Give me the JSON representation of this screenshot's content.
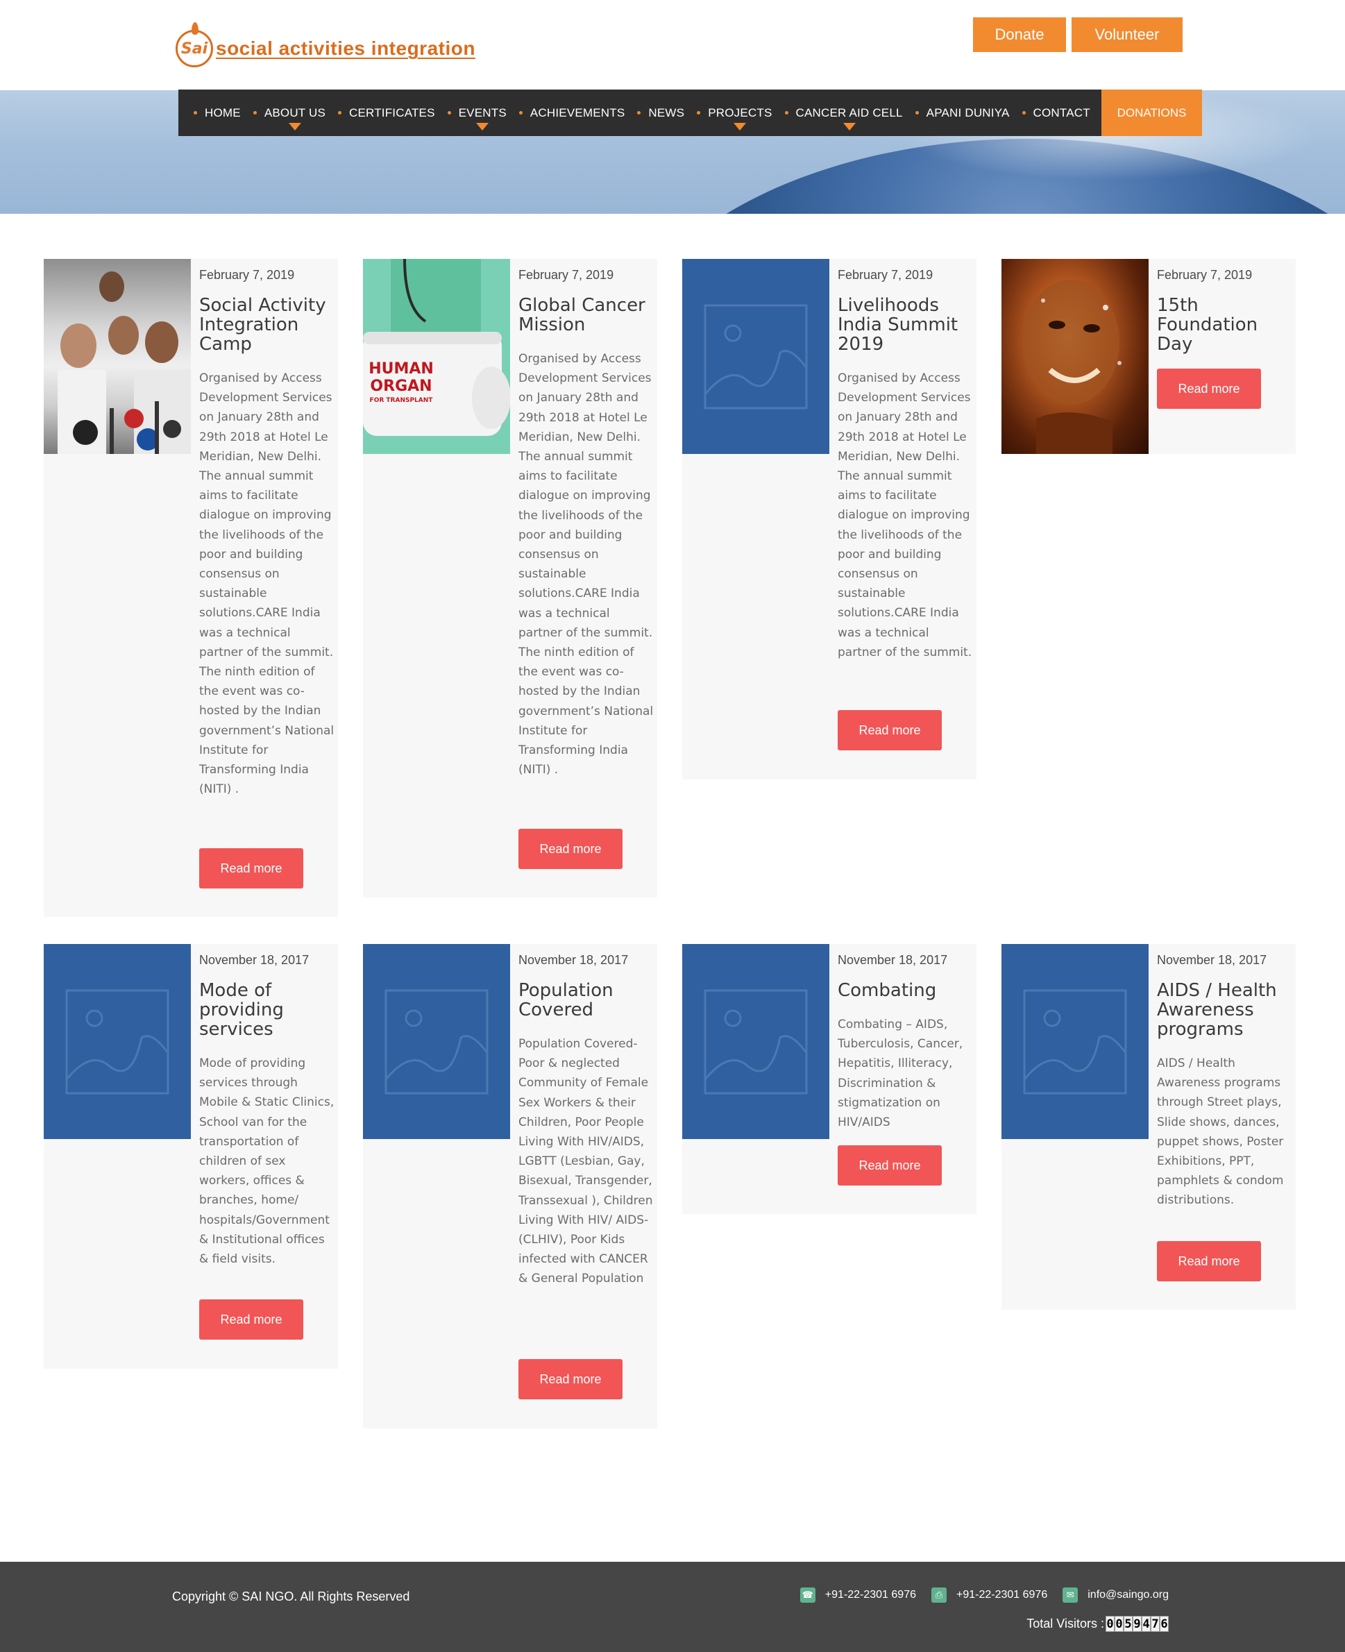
{
  "header": {
    "logo_mark": "Sai",
    "logo_text": "social activities integration",
    "donate_label": "Donate",
    "volunteer_label": "Volunteer"
  },
  "nav": {
    "items": [
      {
        "label": "HOME",
        "dropdown": false
      },
      {
        "label": "ABOUT US",
        "dropdown": true
      },
      {
        "label": "CERTIFICATES",
        "dropdown": false
      },
      {
        "label": "EVENTS",
        "dropdown": true
      },
      {
        "label": "ACHIEVEMENTS",
        "dropdown": false
      },
      {
        "label": "NEWS",
        "dropdown": false
      },
      {
        "label": "PROJECTS",
        "dropdown": true
      },
      {
        "label": "CANCER AID CELL",
        "dropdown": true
      },
      {
        "label": "APANI DUNIYA",
        "dropdown": false
      },
      {
        "label": "CONTACT",
        "dropdown": false
      }
    ],
    "donations_label": "DONATIONS"
  },
  "posts": [
    {
      "date": "February 7, 2019",
      "title": "Social Activity Integration Camp",
      "excerpt": "Organised by Access Development Services on January 28th and 29th 2018 at Hotel Le Meridian, New Delhi. The annual summit aims to facilitate dialogue on improving the livelihoods of the poor and building consensus on sustainable solutions.CARE India was a technical  partner of the summit. The ninth edition of the event was co-hosted by the Indian government’s National Institute for Transforming India (NITI) .",
      "read_more": "Read more",
      "image": "photo-crowd"
    },
    {
      "date": "February 7, 2019",
      "title": "Global Cancer Mission",
      "excerpt": "Organised by Access Development Services on January 28th and 29th 2018 at Hotel Le Meridian, New Delhi. The annual summit aims to facilitate dialogue on improving the livelihoods of the poor and building consensus on sustainable solutions.CARE India was a technical  partner of the summit. The ninth edition of the event was co-hosted by the Indian government’s National Institute for Transforming India (NITI) .",
      "read_more": "Read more",
      "image": "photo-organ",
      "image_caption": "HUMAN ORGAN",
      "image_subcaption": "FOR TRANSPLANT"
    },
    {
      "date": "February 7, 2019",
      "title": "Livelihoods India Summit 2019",
      "excerpt": "Organised by Access Development Services on January 28th and 29th 2018 at Hotel Le Meridian, New Delhi. The annual summit aims to facilitate dialogue on improving the livelihoods of the poor and building consensus on sustainable solutions.CARE India was a technical  partner of the summit.",
      "read_more": "Read more",
      "image": "placeholder-image-icon"
    },
    {
      "date": "February 7, 2019",
      "title": "15th Foundation Day",
      "excerpt": "",
      "read_more": "Read more",
      "image": "photo-water"
    },
    {
      "date": "November 18, 2017",
      "title": "Mode of providing services",
      "excerpt": "Mode of providing services through Mobile & Static Clinics, School van for the transportation of children of sex workers, offices & branches, home/ hospitals/Government & Institutional offices & field visits.",
      "read_more": "Read more",
      "image": "placeholder-image-icon"
    },
    {
      "date": "November 18, 2017",
      "title": "Population Covered",
      "excerpt": "Population Covered- Poor & neglected Community of Female Sex Workers & their Children, Poor People Living With HIV/AIDS, LGBTT (Lesbian, Gay, Bisexual, Transgender, Transsexual ), Children Living With HIV/ AIDS-(CLHIV), Poor Kids infected with CANCER & General Population",
      "read_more": "Read more",
      "image": "placeholder-image-icon"
    },
    {
      "date": "November 18, 2017",
      "title": "Combating",
      "excerpt": "Combating – AIDS, Tuberculosis, Cancer, Hepatitis, Illiteracy, Discrimination & stigmatization on HIV/AIDS",
      "read_more": "Read more",
      "image": "placeholder-image-icon"
    },
    {
      "date": "November 18, 2017",
      "title": "AIDS / Health Awareness programs",
      "excerpt": "AIDS / Health Awareness programs through Street plays, Slide shows, dances, puppet shows, Poster Exhibitions, PPT, pamphlets & condom distributions.",
      "read_more": "Read more",
      "image": "placeholder-image-icon"
    }
  ],
  "footer": {
    "copyright": "Copyright © SAI NGO. All Rights Reserved",
    "phone": "+91-22-2301 6976",
    "fax": "+91-22-2301 6976",
    "email": "info@saingo.org",
    "visitors_label": "Total Visitors :",
    "visitors_digits": [
      "0",
      "0",
      "5",
      "9",
      "4",
      "7",
      "6"
    ]
  },
  "colors": {
    "accent_orange": "#f28a30",
    "read_more_red": "#f25555",
    "placeholder_blue": "#30609f",
    "nav_dark": "#2e2e2e",
    "footer_dark": "#464646",
    "contact_icon_green": "#5fb38f"
  }
}
